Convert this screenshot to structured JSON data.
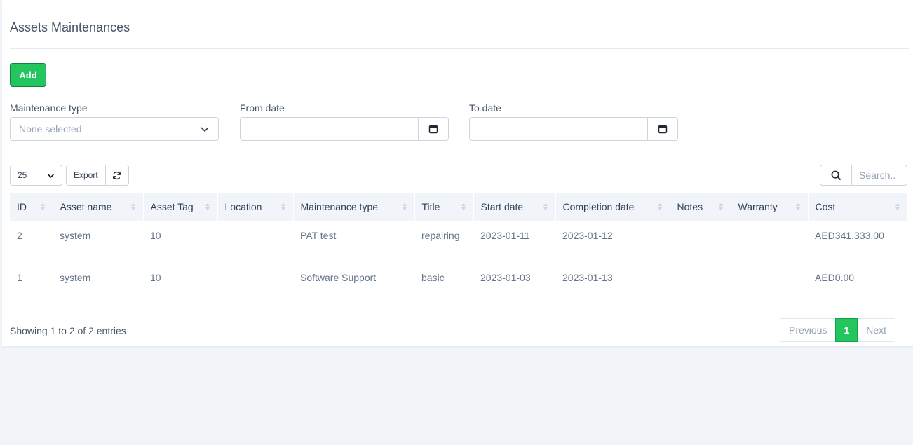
{
  "page": {
    "title": "Assets Maintenances"
  },
  "actions": {
    "add_label": "Add"
  },
  "filters": {
    "maintenance_type": {
      "label": "Maintenance type",
      "placeholder": "None selected"
    },
    "from_date": {
      "label": "From date",
      "value": ""
    },
    "to_date": {
      "label": "To date",
      "value": ""
    }
  },
  "toolbar": {
    "page_length": "25",
    "export_label": "Export",
    "search_placeholder": "Search.."
  },
  "table": {
    "columns": [
      "ID",
      "Asset name",
      "Asset Tag",
      "Location",
      "Maintenance type",
      "Title",
      "Start date",
      "Completion date",
      "Notes",
      "Warranty",
      "Cost"
    ],
    "rows": [
      [
        "2",
        "system",
        "10",
        "",
        "PAT test",
        "repairing",
        "2023-01-11",
        "2023-01-12",
        "",
        "",
        "AED341,333.00"
      ],
      [
        "1",
        "system",
        "10",
        "",
        "Software Support",
        "basic",
        "2023-01-03",
        "2023-01-13",
        "",
        "",
        "AED0.00"
      ]
    ]
  },
  "footer": {
    "info": "Showing 1 to 2 of 2 entries",
    "pagination": {
      "previous": "Previous",
      "current": "1",
      "next": "Next"
    }
  },
  "colors": {
    "accent": "#22c55e",
    "header_bg": "#f1f4f9",
    "page_bg": "#f1f4f9"
  },
  "icons": [
    "chevron-down-icon",
    "calendar-icon",
    "refresh-icon",
    "search-icon",
    "sort-icon"
  ]
}
